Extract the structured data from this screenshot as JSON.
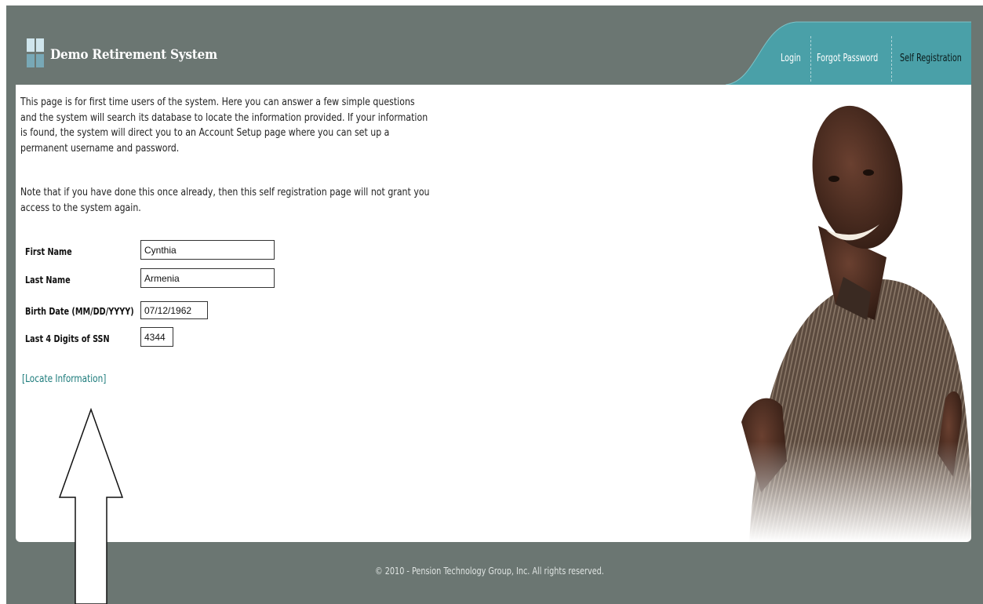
{
  "header": {
    "app_title": "Demo Retirement System",
    "nav": {
      "login": "Login",
      "forgot_password": "Forgot Password",
      "self_registration": "Self Registration"
    },
    "colors": {
      "nav_tab": "#4aa0a8",
      "background": "#6b7672"
    }
  },
  "main": {
    "intro_text": "This page is for first time users of the system.  Here you can answer a few simple questions and the system will search its database to locate the information provided.  If your information is found, the system will direct you to an Account Setup page where you can set up a permanent username and password.",
    "note_text": "Note that if you have done this once already, then this self registration page will not grant you access to the system again.",
    "form": {
      "first_name_label": "First Name",
      "first_name_value": "Cynthia",
      "last_name_label": "Last Name",
      "last_name_value": "Armenia",
      "birth_date_label": "Birth Date (MM/DD/YYYY)",
      "birth_date_value": "07/12/1962",
      "ssn_label": "Last 4 Digits of SSN",
      "ssn_value": "4344"
    },
    "locate_link": "[Locate Information]",
    "link_color": "#1a7a7a"
  },
  "footer": {
    "copyright": "© 2010 - Pension Technology Group, Inc. All rights reserved."
  },
  "annotation": {
    "icon": "up-arrow-icon"
  }
}
